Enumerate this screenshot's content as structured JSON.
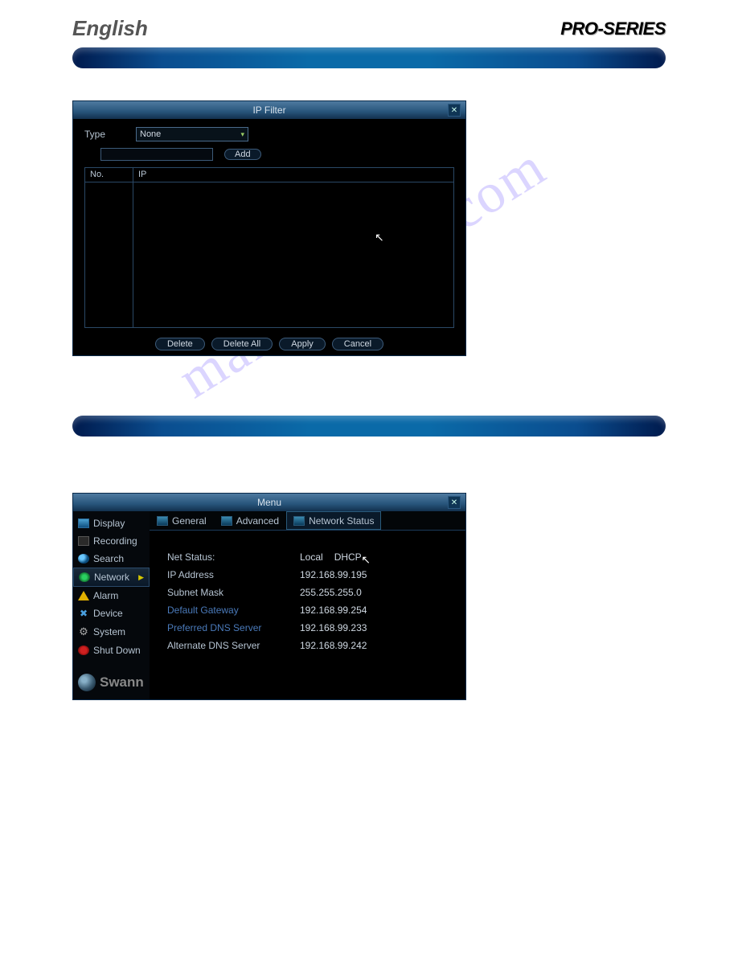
{
  "header": {
    "language": "English",
    "product": "PRO-SERIES"
  },
  "watermark": "manualshive.com",
  "ipFilter": {
    "title": "IP Filter",
    "typeLabel": "Type",
    "typeValue": "None",
    "addBtn": "Add",
    "columns": {
      "no": "No.",
      "ip": "IP"
    },
    "buttons": {
      "delete": "Delete",
      "deleteAll": "Delete All",
      "apply": "Apply",
      "cancel": "Cancel"
    }
  },
  "menu": {
    "title": "Menu",
    "sidebar": {
      "display": "Display",
      "recording": "Recording",
      "search": "Search",
      "network": "Network",
      "alarm": "Alarm",
      "device": "Device",
      "system": "System",
      "shutdown": "Shut Down"
    },
    "brand": "Swann",
    "tabs": {
      "general": "General",
      "advanced": "Advanced",
      "networkStatus": "Network Status"
    },
    "status": {
      "netStatusLabel": "Net Status:",
      "netStatusLocal": "Local",
      "netStatusDhcp": "DHCP",
      "ipAddressLabel": "IP Address",
      "ipAddress": "192.168.99.195",
      "subnetLabel": "Subnet Mask",
      "subnet": "255.255.255.0",
      "gatewayLabel": "Default Gateway",
      "gateway": "192.168.99.254",
      "prefDnsLabel": "Preferred DNS Server",
      "prefDns": "192.168.99.233",
      "altDnsLabel": "Alternate DNS Server",
      "altDns": "192.168.99.242"
    }
  }
}
